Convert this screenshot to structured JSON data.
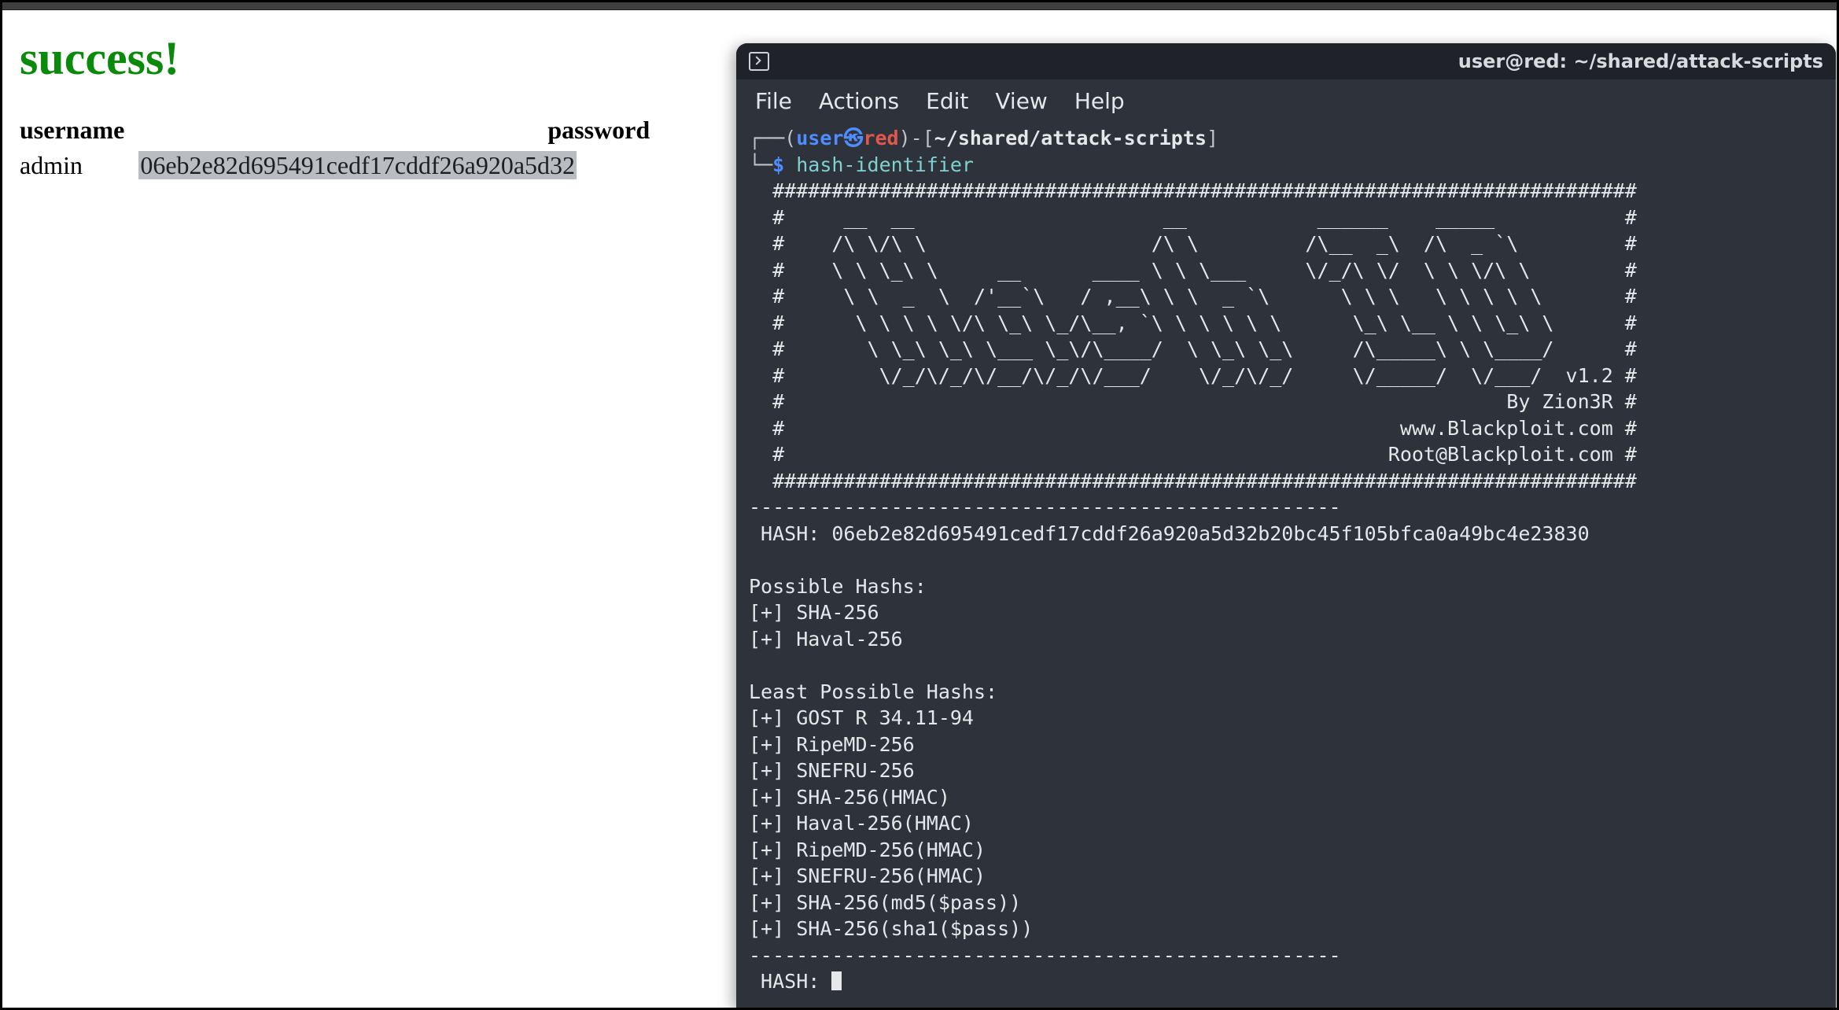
{
  "page": {
    "heading": "success!",
    "table": {
      "headers": {
        "user": "username",
        "pass": "password"
      },
      "row": {
        "user": "admin",
        "hash_visible": "06eb2e82d695491cedf17cddf26a920a5d32"
      }
    }
  },
  "terminal": {
    "title": "user@red: ~/shared/attack-scripts",
    "menus": [
      "File",
      "Actions",
      "Edit",
      "View",
      "Help"
    ],
    "prompt": {
      "user": "user",
      "host": "red",
      "path": "~/shared/attack-scripts",
      "command": "hash-identifier"
    },
    "banner": [
      "  #########################################################################",
      "  #     __  __                     __           ______    _____           #",
      "  #    /\\ \\/\\ \\                   /\\ \\         /\\__  _\\  /\\  _ `\\         #",
      "  #    \\ \\ \\_\\ \\     __      ____ \\ \\ \\___     \\/_/\\ \\/  \\ \\ \\/\\ \\        #",
      "  #     \\ \\  _  \\  /'__`\\   / ,__\\ \\ \\  _ `\\      \\ \\ \\   \\ \\ \\ \\ \\       #",
      "  #      \\ \\ \\ \\ \\/\\ \\_\\ \\_/\\__, `\\ \\ \\ \\ \\ \\      \\_\\ \\__ \\ \\ \\_\\ \\      #",
      "  #       \\ \\_\\ \\_\\ \\___ \\_\\/\\____/  \\ \\_\\ \\_\\     /\\_____\\ \\ \\____/      #",
      "  #        \\/_/\\/_/\\/__/\\/_/\\/___/    \\/_/\\/_/     \\/_____/  \\/___/  v1.2 #",
      "  #                                                             By Zion3R #",
      "  #                                                    www.Blackploit.com #",
      "  #                                                   Root@Blackploit.com #",
      "  #########################################################################"
    ],
    "rule": "--------------------------------------------------",
    "hash_line_label": " HASH: ",
    "hash_value": "06eb2e82d695491cedf17cddf26a920a5d32b20bc45f105bfca0a49bc4e23830",
    "possible_label": "Possible Hashs:",
    "possible": [
      "SHA-256",
      "Haval-256"
    ],
    "least_label": "Least Possible Hashs:",
    "least": [
      "GOST R 34.11-94",
      "RipeMD-256",
      "SNEFRU-256",
      "SHA-256(HMAC)",
      "Haval-256(HMAC)",
      "RipeMD-256(HMAC)",
      "SNEFRU-256(HMAC)",
      "SHA-256(md5($pass))",
      "SHA-256(sha1($pass))"
    ],
    "prompt2_label": " HASH: "
  }
}
